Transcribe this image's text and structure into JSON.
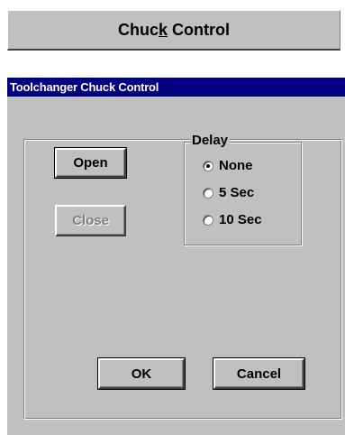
{
  "header": {
    "title_prefix": "Chuc",
    "title_underlined": "k",
    "title_suffix": " Control"
  },
  "dialog": {
    "title": "Toolchanger Chuck Control",
    "open_label": "Open",
    "close_label": "Close",
    "ok_label": "OK",
    "cancel_label": "Cancel",
    "delay": {
      "legend": "Delay",
      "options": [
        "None",
        "5 Sec",
        "10 Sec"
      ],
      "selected": "None"
    }
  }
}
